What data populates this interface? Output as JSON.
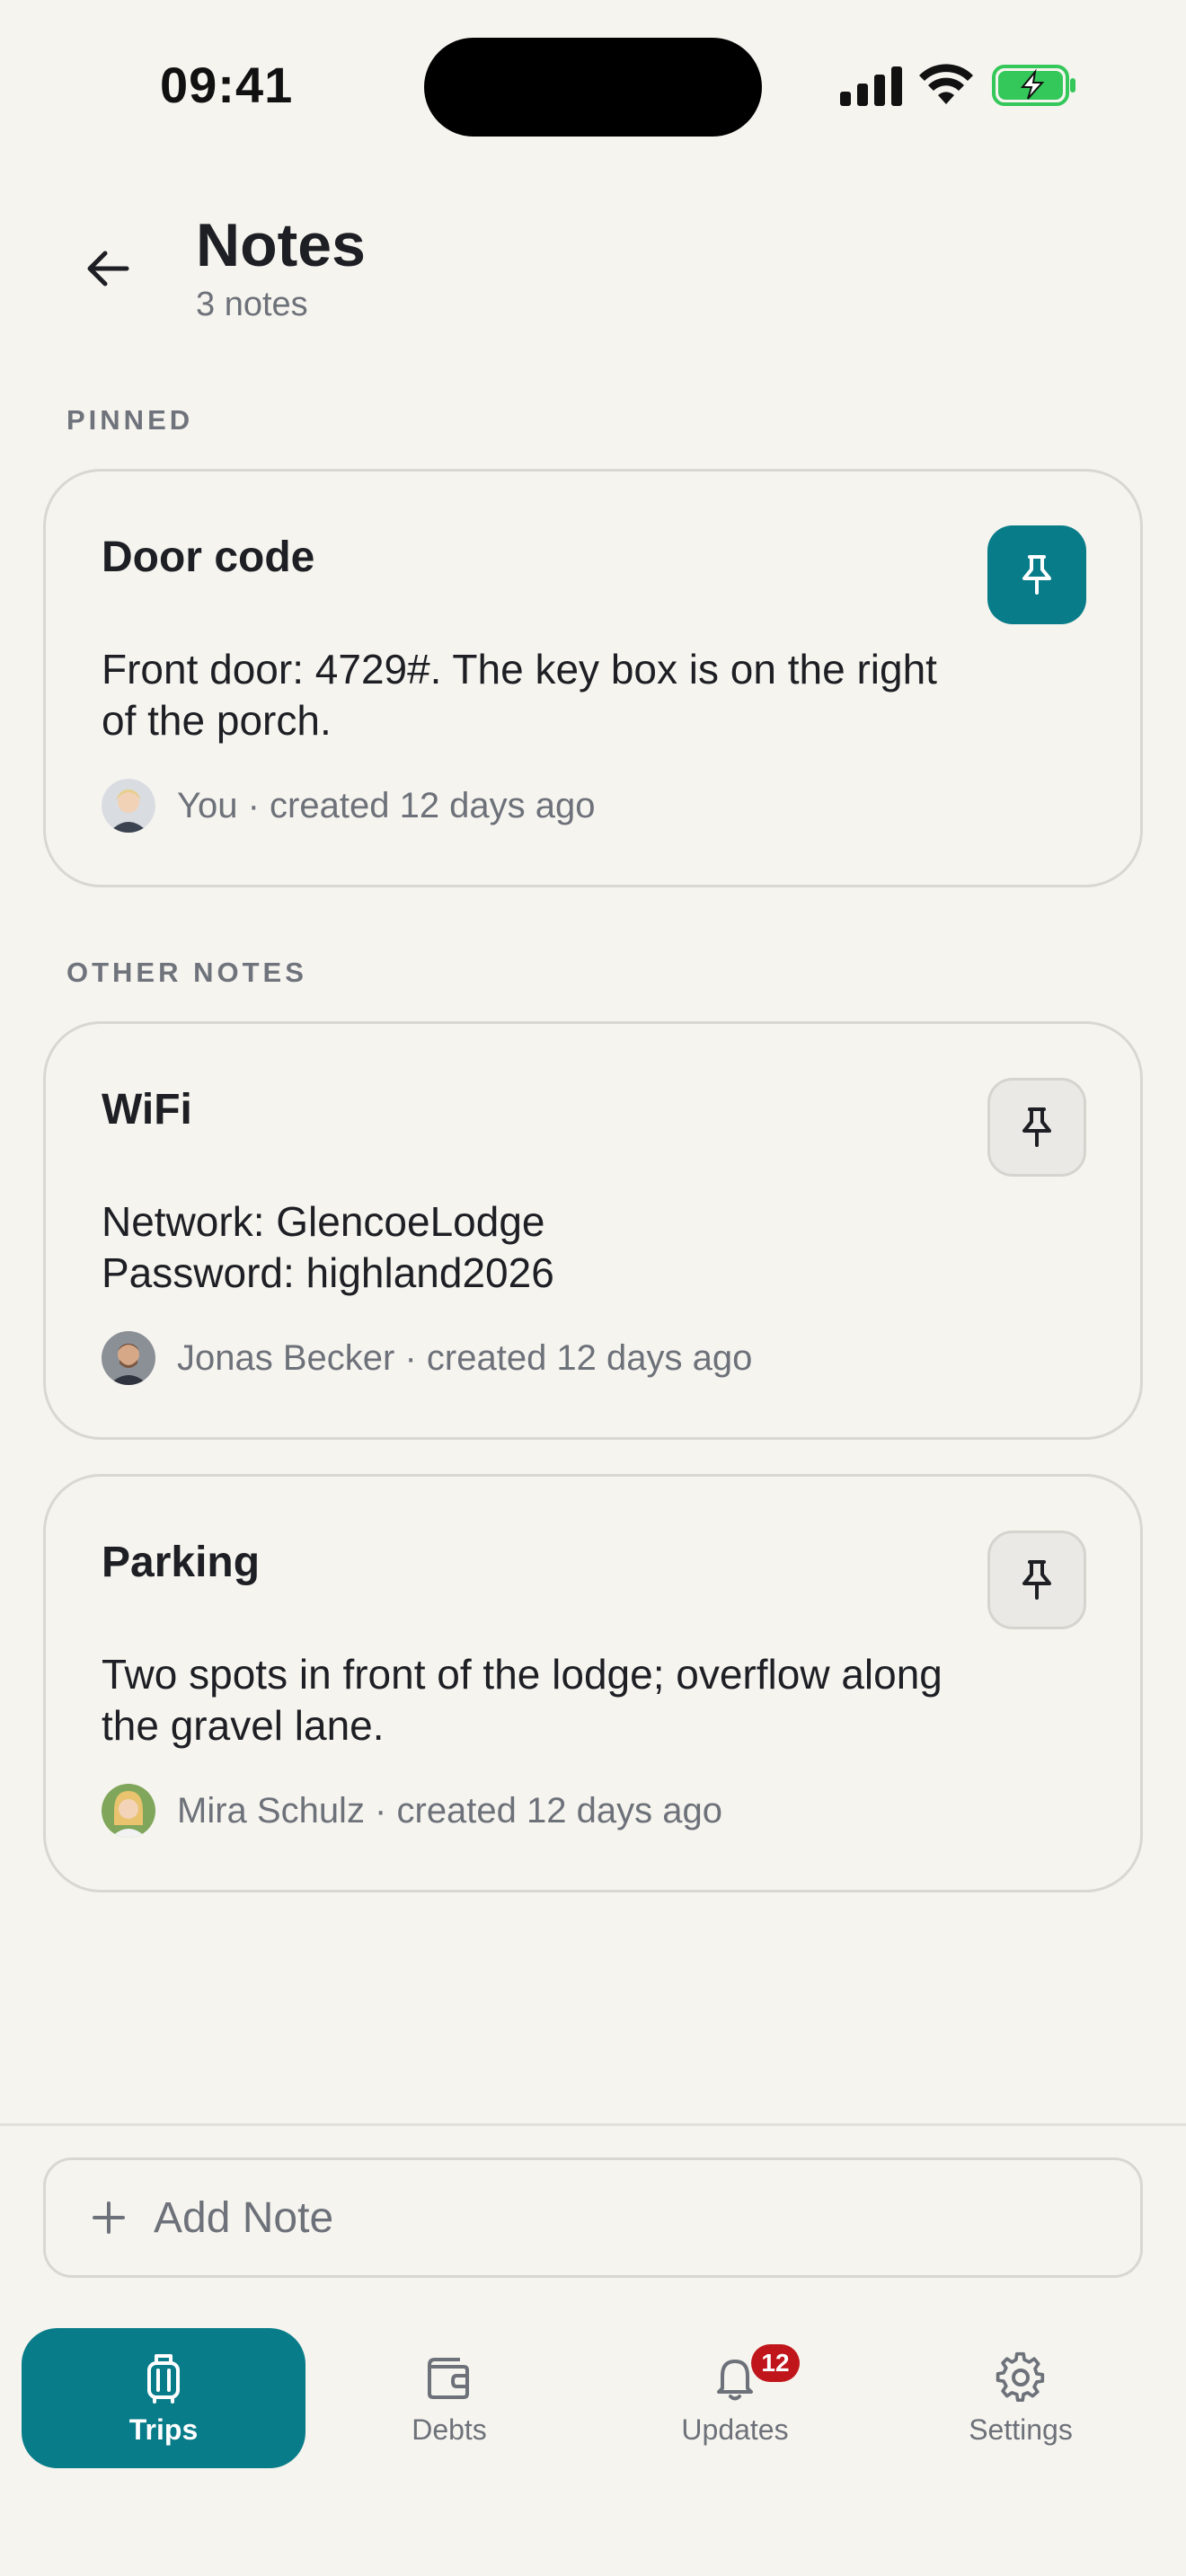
{
  "status_bar": {
    "time": "09:41"
  },
  "header": {
    "title": "Notes",
    "subtitle": "3 notes"
  },
  "sections": {
    "pinned_label": "PINNED",
    "other_label": "OTHER NOTES"
  },
  "notes": [
    {
      "title": "Door code",
      "body": "Front door: 4729#. The key box is on the right\nof the porch.",
      "meta": "You · created 12 days ago",
      "pinned": true
    },
    {
      "title": "WiFi",
      "body": "Network: GlencoeLodge\nPassword: highland2026",
      "meta": "Jonas Becker · created 12 days ago",
      "pinned": false
    },
    {
      "title": "Parking",
      "body": "Two spots in front of the lodge; overflow along\nthe gravel lane.",
      "meta": "Mira Schulz · created 12 days ago",
      "pinned": false
    }
  ],
  "add_note": {
    "label": "Add Note",
    "icon": "plus-icon"
  },
  "tabs": [
    {
      "label": "Trips",
      "icon": "suitcase-icon",
      "active": true
    },
    {
      "label": "Debts",
      "icon": "wallet-icon",
      "active": false
    },
    {
      "label": "Updates",
      "icon": "bell-icon",
      "active": false,
      "badge": "12"
    },
    {
      "label": "Settings",
      "icon": "gear-icon",
      "active": false
    }
  ],
  "colors": {
    "accent": "#087c89",
    "background": "#f6f4ef",
    "badge": "#c0161b",
    "battery": "#34c759"
  }
}
